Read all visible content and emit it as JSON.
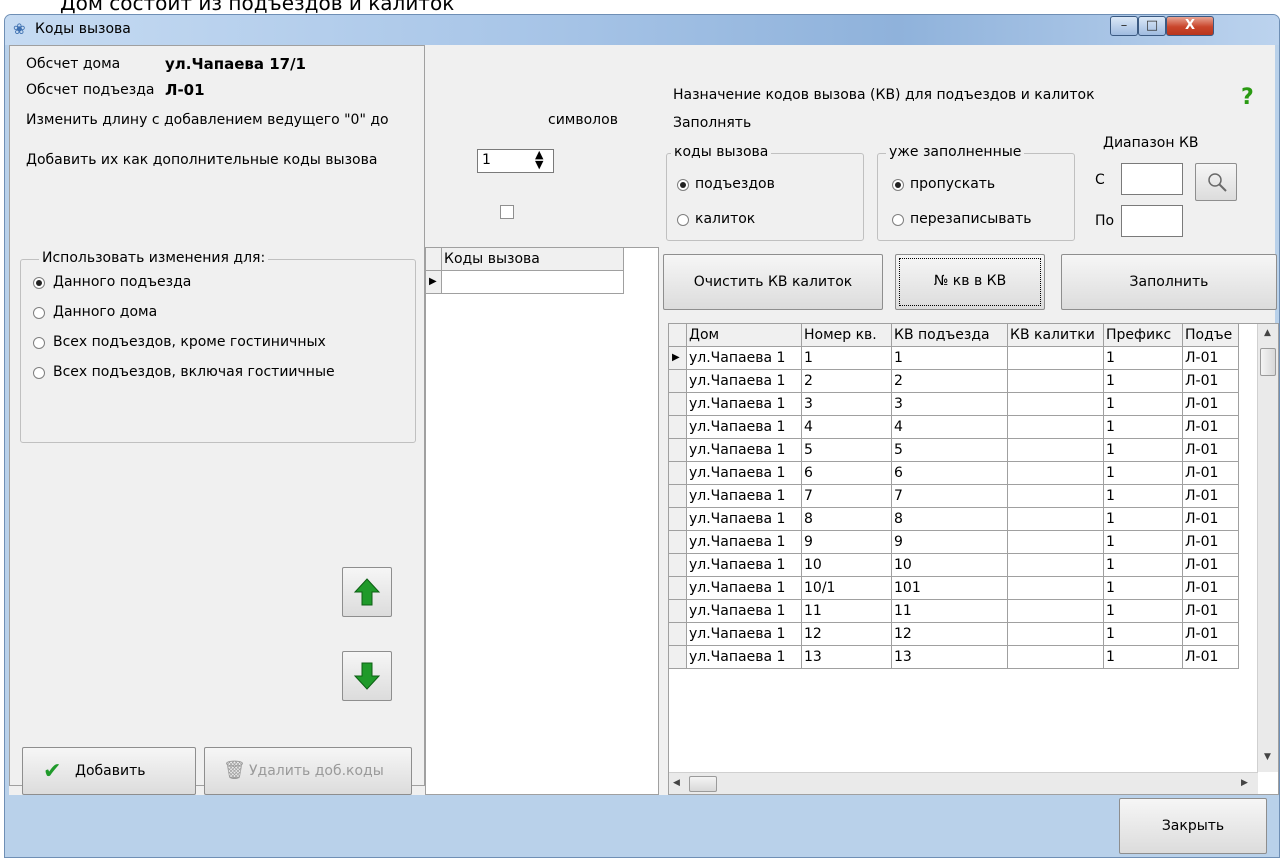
{
  "top_clipped_text": "Дом состоит из подъездов и калиток",
  "window": {
    "title": "Коды вызова",
    "min": "–",
    "max": "□",
    "close": "X"
  },
  "left": {
    "house_label": "Обсчет дома",
    "house_value": "ул.Чапаева 17/1",
    "entrance_label": "Обсчет подъезда",
    "entrance_value": "Л-01",
    "change_length_label": "Изменить длину с добавлением ведущего \"0\" до",
    "length_value": "1",
    "symbols_label": "символов",
    "add_as_extra_label": "Добавить их как дополнительные коды вызова",
    "use_changes_title": "Использовать изменения для:",
    "radios": [
      {
        "label": "Данного подъезда",
        "checked": true
      },
      {
        "label": "Данного дома",
        "checked": false
      },
      {
        "label": "Всех подъездов, кроме гостиничных",
        "checked": false
      },
      {
        "label": "Всех подъездов, включая гостиичные",
        "checked": false
      }
    ],
    "codes_grid_header": "Коды вызова",
    "add_button": "Добавить",
    "delete_button": "Удалить доб.коды"
  },
  "right": {
    "header": "Назначение кодов вызова (КВ) для подъездов и калиток",
    "fill_label": "Заполнять",
    "help": "?",
    "codes_group_title": "коды вызова",
    "codes_options": [
      {
        "label": "подъездов",
        "checked": true
      },
      {
        "label": "калиток",
        "checked": false
      }
    ],
    "filled_group_title": "уже заполненные",
    "filled_options": [
      {
        "label": "пропускать",
        "checked": true
      },
      {
        "label": "перезаписывать",
        "checked": false
      }
    ],
    "range_title": "Диапазон КВ",
    "from_label": "С",
    "to_label": "По",
    "from_value": "",
    "to_value": "",
    "clear_button": "Очистить КВ калиток",
    "apt_button": "№ кв в КВ",
    "fill_button": "Заполнить",
    "columns": [
      "Дом",
      "Номер кв.",
      "КВ подъезда",
      "КВ калитки",
      "Префикс",
      "Подъе"
    ],
    "rows": [
      [
        "ул.Чапаева 1",
        "1",
        "1",
        "",
        "1",
        "Л-01"
      ],
      [
        "ул.Чапаева 1",
        "2",
        "2",
        "",
        "1",
        "Л-01"
      ],
      [
        "ул.Чапаева 1",
        "3",
        "3",
        "",
        "1",
        "Л-01"
      ],
      [
        "ул.Чапаева 1",
        "4",
        "4",
        "",
        "1",
        "Л-01"
      ],
      [
        "ул.Чапаева 1",
        "5",
        "5",
        "",
        "1",
        "Л-01"
      ],
      [
        "ул.Чапаева 1",
        "6",
        "6",
        "",
        "1",
        "Л-01"
      ],
      [
        "ул.Чапаева 1",
        "7",
        "7",
        "",
        "1",
        "Л-01"
      ],
      [
        "ул.Чапаева 1",
        "8",
        "8",
        "",
        "1",
        "Л-01"
      ],
      [
        "ул.Чапаева 1",
        "9",
        "9",
        "",
        "1",
        "Л-01"
      ],
      [
        "ул.Чапаева 1",
        "10",
        "10",
        "",
        "1",
        "Л-01"
      ],
      [
        "ул.Чапаева 1",
        "10/1",
        "101",
        "",
        "1",
        "Л-01"
      ],
      [
        "ул.Чапаева 1",
        "11",
        "11",
        "",
        "1",
        "Л-01"
      ],
      [
        "ул.Чапаева 1",
        "12",
        "12",
        "",
        "1",
        "Л-01"
      ],
      [
        "ул.Чапаева 1",
        "13",
        "13",
        "",
        "1",
        "Л-01"
      ]
    ]
  },
  "footer": {
    "close_button": "Закрыть"
  },
  "colors": {
    "accent_green": "#1f9a2a",
    "window_frame": "#b9d1ea",
    "close_red": "#c9452b"
  }
}
